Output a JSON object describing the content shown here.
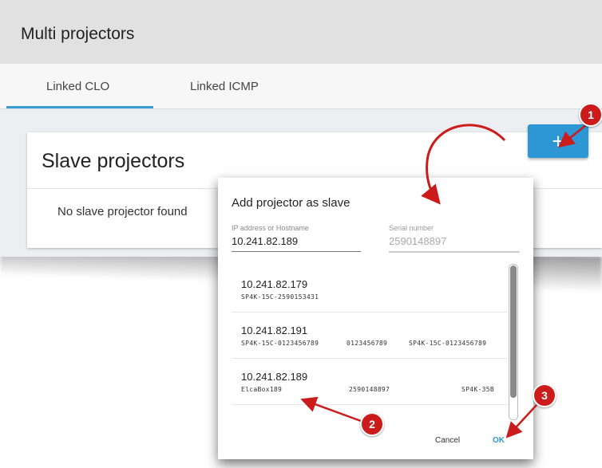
{
  "window": {
    "title": "Multi projectors",
    "tabs": [
      {
        "label": "Linked CLO",
        "active": true
      },
      {
        "label": "Linked ICMP",
        "active": false
      }
    ],
    "card": {
      "title": "Slave projectors",
      "empty_text": "No slave projector found",
      "add_button": "+"
    }
  },
  "dialog": {
    "title": "Add projector as slave",
    "ip_field": {
      "label": "IP address or Hostname",
      "value": "10.241.82.189"
    },
    "serial_field": {
      "label": "Serial number",
      "value": "2590148897"
    },
    "items": [
      {
        "ip": "10.241.82.179",
        "name": "SP4K-15C-2590153431",
        "serial": "",
        "model": ""
      },
      {
        "ip": "10.241.82.191",
        "name": "SP4K-15C-0123456789",
        "serial": "0123456789",
        "model": "SP4K-15C-0123456789"
      },
      {
        "ip": "10.241.82.189",
        "name": "ElcaBox189",
        "serial": "2590148897",
        "model": "SP4K-35B"
      }
    ],
    "cancel_label": "Cancel",
    "ok_label": "OK"
  },
  "callouts": [
    "1",
    "2",
    "3"
  ],
  "colors": {
    "accent": "#2d96d4",
    "callout": "#cc1b1b",
    "tab_indicator": "#3a9bd5"
  }
}
